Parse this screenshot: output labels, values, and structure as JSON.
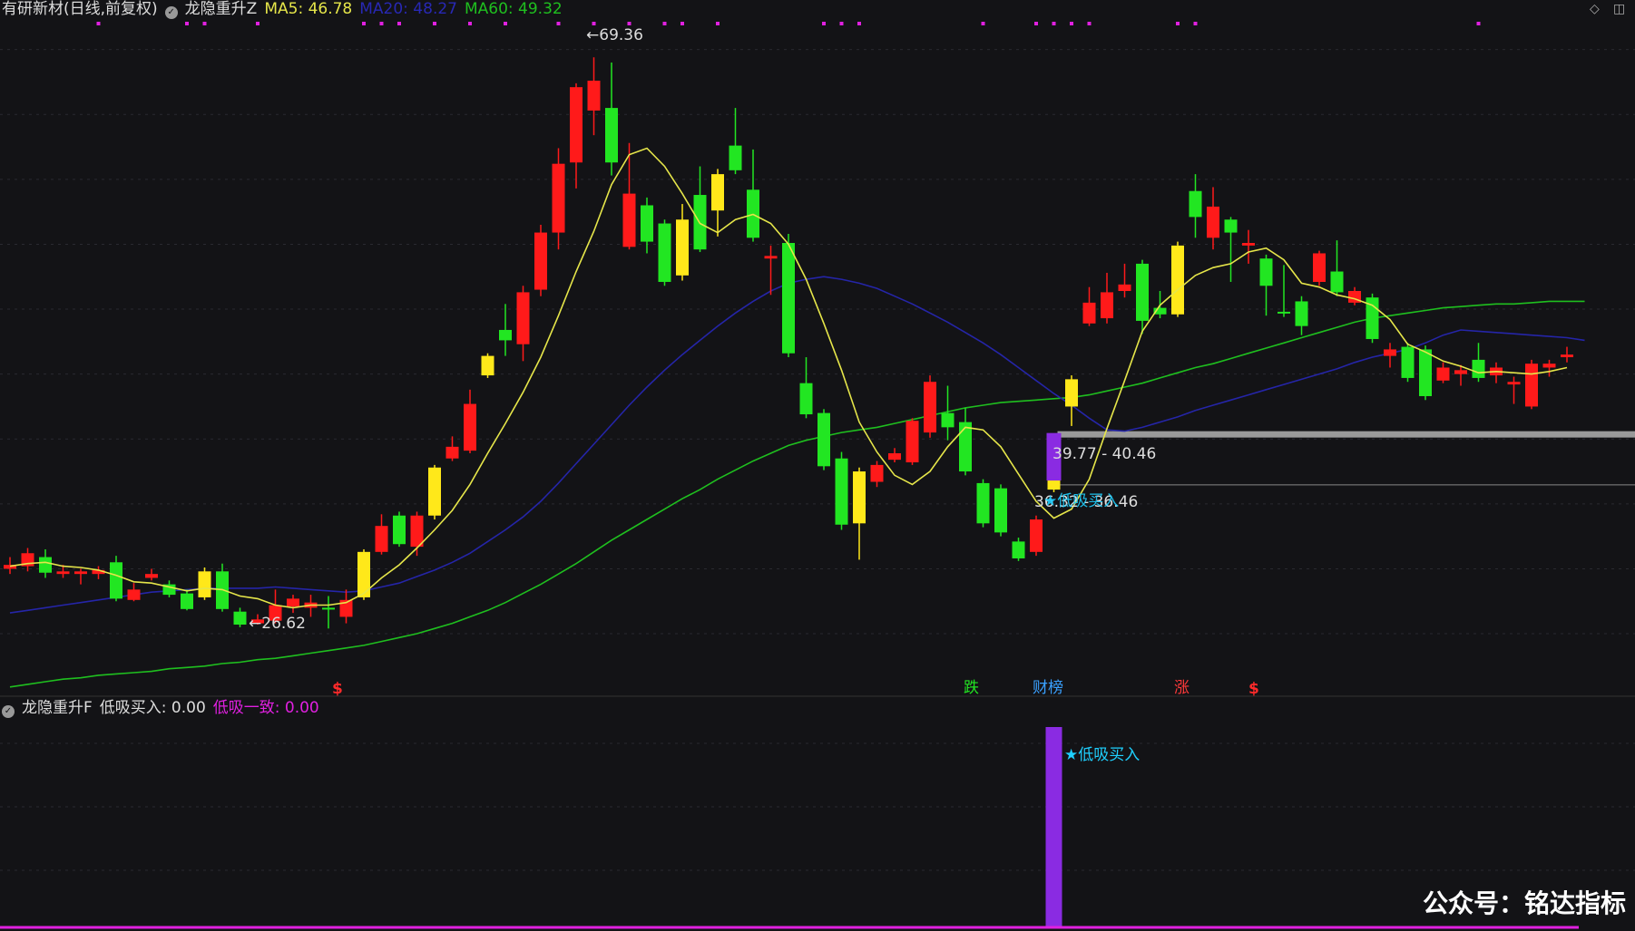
{
  "header": {
    "stock_title": "有研新材(日线,前复权)",
    "indicator_name": "龙隐重升Z",
    "ma5_label": "MA5: 46.78",
    "ma20_label": "MA20: 48.27",
    "ma60_label": "MA60: 49.32"
  },
  "sub_header": {
    "indicator_name": "龙隐重升F",
    "buy_label": "低吸买入: 0.00",
    "consensus_label": "低吸一致: 0.00"
  },
  "annotations": {
    "high": "69.36",
    "low": "26.62",
    "zone1": "39.77 - 40.46",
    "zone2": "36.32 - 36.46",
    "buy_signal": "★低吸买入",
    "sub_buy_signal": "★低吸买入",
    "dollar": "$",
    "die": "跌",
    "caibang": "财榜",
    "zhang": "涨"
  },
  "watermark": "公众号：铭达指标",
  "colors": {
    "background": "#131316",
    "up": "#ff1a1a",
    "down": "#22e622",
    "flat": "#ffe81a",
    "ma5": "#e6e64a",
    "ma20": "#2525a8",
    "ma60": "#1fbf1f",
    "signal": "#8a2be2",
    "magenta": "#e020e0",
    "cyan": "#1fd0ff"
  },
  "chart_data": {
    "type": "candlestick",
    "ylim": [
      22,
      72
    ],
    "candles": [
      {
        "o": 30.0,
        "c": 30.3,
        "h": 30.9,
        "l": 29.6,
        "t": "r"
      },
      {
        "o": 30.2,
        "c": 31.2,
        "h": 31.6,
        "l": 29.8,
        "t": "r"
      },
      {
        "o": 30.9,
        "c": 29.7,
        "h": 31.5,
        "l": 29.3,
        "t": "g"
      },
      {
        "o": 29.6,
        "c": 29.8,
        "h": 30.3,
        "l": 29.3,
        "t": "r"
      },
      {
        "o": 29.6,
        "c": 29.8,
        "h": 30.0,
        "l": 28.8,
        "t": "r"
      },
      {
        "o": 29.6,
        "c": 29.9,
        "h": 30.2,
        "l": 29.2,
        "t": "r"
      },
      {
        "o": 30.5,
        "c": 27.7,
        "h": 31.0,
        "l": 27.5,
        "t": "g"
      },
      {
        "o": 27.6,
        "c": 28.4,
        "h": 28.9,
        "l": 27.5,
        "t": "r"
      },
      {
        "o": 29.3,
        "c": 29.6,
        "h": 30.0,
        "l": 29.1,
        "t": "r"
      },
      {
        "o": 28.8,
        "c": 28.0,
        "h": 29.1,
        "l": 27.8,
        "t": "g"
      },
      {
        "o": 28.1,
        "c": 26.9,
        "h": 28.4,
        "l": 26.8,
        "t": "g"
      },
      {
        "o": 27.8,
        "c": 29.8,
        "h": 30.1,
        "l": 27.6,
        "t": "y"
      },
      {
        "o": 29.8,
        "c": 26.9,
        "h": 30.4,
        "l": 26.7,
        "t": "g"
      },
      {
        "o": 26.7,
        "c": 25.7,
        "h": 27.0,
        "l": 25.5,
        "t": "g"
      },
      {
        "o": 25.8,
        "c": 26.1,
        "h": 26.5,
        "l": 25.7,
        "t": "r"
      },
      {
        "o": 26.0,
        "c": 27.2,
        "h": 28.4,
        "l": 25.8,
        "t": "r"
      },
      {
        "o": 27.1,
        "c": 27.7,
        "h": 28.0,
        "l": 26.6,
        "t": "r"
      },
      {
        "o": 27.0,
        "c": 27.4,
        "h": 28.0,
        "l": 26.3,
        "t": "r"
      },
      {
        "o": 26.9,
        "c": 27.0,
        "h": 27.9,
        "l": 25.4,
        "t": "g"
      },
      {
        "o": 26.3,
        "c": 27.6,
        "h": 28.4,
        "l": 25.8,
        "t": "r"
      },
      {
        "o": 27.8,
        "c": 31.3,
        "h": 31.5,
        "l": 27.6,
        "t": "y"
      },
      {
        "o": 31.3,
        "c": 33.3,
        "h": 34.2,
        "l": 31.1,
        "t": "r"
      },
      {
        "o": 34.1,
        "c": 31.9,
        "h": 34.4,
        "l": 31.7,
        "t": "g"
      },
      {
        "o": 31.7,
        "c": 34.1,
        "h": 34.4,
        "l": 31.0,
        "t": "r"
      },
      {
        "o": 34.1,
        "c": 37.8,
        "h": 38.0,
        "l": 33.8,
        "t": "y"
      },
      {
        "o": 38.5,
        "c": 39.4,
        "h": 40.2,
        "l": 38.3,
        "t": "r"
      },
      {
        "o": 39.1,
        "c": 42.7,
        "h": 43.8,
        "l": 38.9,
        "t": "r"
      },
      {
        "o": 44.9,
        "c": 46.4,
        "h": 46.6,
        "l": 44.7,
        "t": "y"
      },
      {
        "o": 48.4,
        "c": 47.6,
        "h": 50.4,
        "l": 46.4,
        "t": "g"
      },
      {
        "o": 47.3,
        "c": 51.3,
        "h": 51.8,
        "l": 46.0,
        "t": "r"
      },
      {
        "o": 51.5,
        "c": 55.9,
        "h": 56.5,
        "l": 51.0,
        "t": "r"
      },
      {
        "o": 55.9,
        "c": 61.2,
        "h": 62.4,
        "l": 54.6,
        "t": "r"
      },
      {
        "o": 61.3,
        "c": 67.1,
        "h": 67.4,
        "l": 59.3,
        "t": "r"
      },
      {
        "o": 65.3,
        "c": 67.6,
        "h": 69.4,
        "l": 63.4,
        "t": "r"
      },
      {
        "o": 65.5,
        "c": 61.3,
        "h": 69.0,
        "l": 60.3,
        "t": "g"
      },
      {
        "o": 54.8,
        "c": 58.9,
        "h": 62.8,
        "l": 54.6,
        "t": "r"
      },
      {
        "o": 58.0,
        "c": 55.2,
        "h": 58.6,
        "l": 54.3,
        "t": "g"
      },
      {
        "o": 56.6,
        "c": 52.1,
        "h": 56.9,
        "l": 51.8,
        "t": "g"
      },
      {
        "o": 56.9,
        "c": 52.6,
        "h": 58.1,
        "l": 52.2,
        "t": "y"
      },
      {
        "o": 54.6,
        "c": 58.8,
        "h": 61.0,
        "l": 54.4,
        "t": "g"
      },
      {
        "o": 57.6,
        "c": 60.4,
        "h": 60.8,
        "l": 55.6,
        "t": "y"
      },
      {
        "o": 60.7,
        "c": 62.6,
        "h": 65.5,
        "l": 60.4,
        "t": "g"
      },
      {
        "o": 59.2,
        "c": 55.5,
        "h": 62.3,
        "l": 55.2,
        "t": "g"
      },
      {
        "o": 53.9,
        "c": 54.1,
        "h": 54.9,
        "l": 51.1,
        "t": "r"
      },
      {
        "o": 55.1,
        "c": 46.6,
        "h": 55.8,
        "l": 46.3,
        "t": "g"
      },
      {
        "o": 44.3,
        "c": 41.9,
        "h": 46.3,
        "l": 41.6,
        "t": "g"
      },
      {
        "o": 42.0,
        "c": 37.9,
        "h": 42.3,
        "l": 37.6,
        "t": "g"
      },
      {
        "o": 38.5,
        "c": 33.4,
        "h": 39.0,
        "l": 33.0,
        "t": "g"
      },
      {
        "o": 37.5,
        "c": 33.5,
        "h": 37.8,
        "l": 30.7,
        "t": "y"
      },
      {
        "o": 38.0,
        "c": 36.7,
        "h": 38.3,
        "l": 36.3,
        "t": "r"
      },
      {
        "o": 38.4,
        "c": 38.9,
        "h": 39.3,
        "l": 38.2,
        "t": "r"
      },
      {
        "o": 38.2,
        "c": 41.4,
        "h": 41.6,
        "l": 38.0,
        "t": "r"
      },
      {
        "o": 40.5,
        "c": 44.4,
        "h": 44.9,
        "l": 40.1,
        "t": "r"
      },
      {
        "o": 42.0,
        "c": 40.9,
        "h": 44.1,
        "l": 39.9,
        "t": "g"
      },
      {
        "o": 41.3,
        "c": 37.5,
        "h": 42.4,
        "l": 37.2,
        "t": "g"
      },
      {
        "o": 36.6,
        "c": 33.5,
        "h": 36.9,
        "l": 33.2,
        "t": "g"
      },
      {
        "o": 36.2,
        "c": 32.8,
        "h": 36.5,
        "l": 32.5,
        "t": "g"
      },
      {
        "o": 32.1,
        "c": 30.8,
        "h": 32.4,
        "l": 30.6,
        "t": "g"
      },
      {
        "o": 31.3,
        "c": 33.8,
        "h": 34.1,
        "l": 31.0,
        "t": "r"
      },
      {
        "o": 36.1,
        "c": 39.1,
        "h": 39.4,
        "l": 35.9,
        "t": "y"
      },
      {
        "o": 42.5,
        "c": 44.6,
        "h": 44.9,
        "l": 41.0,
        "t": "y"
      },
      {
        "o": 48.9,
        "c": 50.5,
        "h": 51.7,
        "l": 48.7,
        "t": "r"
      },
      {
        "o": 49.3,
        "c": 51.3,
        "h": 52.8,
        "l": 48.9,
        "t": "r"
      },
      {
        "o": 51.4,
        "c": 51.9,
        "h": 53.5,
        "l": 50.9,
        "t": "r"
      },
      {
        "o": 53.5,
        "c": 49.1,
        "h": 53.8,
        "l": 48.1,
        "t": "g"
      },
      {
        "o": 50.1,
        "c": 49.6,
        "h": 51.4,
        "l": 49.3,
        "t": "g"
      },
      {
        "o": 49.6,
        "c": 54.9,
        "h": 55.2,
        "l": 49.4,
        "t": "y"
      },
      {
        "o": 59.1,
        "c": 57.1,
        "h": 60.4,
        "l": 55.5,
        "t": "g"
      },
      {
        "o": 57.9,
        "c": 55.5,
        "h": 59.4,
        "l": 54.6,
        "t": "r"
      },
      {
        "o": 56.9,
        "c": 55.9,
        "h": 57.1,
        "l": 52.1,
        "t": "g"
      },
      {
        "o": 54.9,
        "c": 55.1,
        "h": 56.1,
        "l": 53.5,
        "t": "r"
      },
      {
        "o": 53.9,
        "c": 51.8,
        "h": 54.2,
        "l": 49.5,
        "t": "g"
      },
      {
        "o": 49.8,
        "c": 49.7,
        "h": 53.4,
        "l": 49.4,
        "t": "g"
      },
      {
        "o": 50.6,
        "c": 48.7,
        "h": 51.0,
        "l": 48.0,
        "t": "g"
      },
      {
        "o": 52.1,
        "c": 54.3,
        "h": 54.5,
        "l": 51.8,
        "t": "r"
      },
      {
        "o": 52.9,
        "c": 51.3,
        "h": 55.3,
        "l": 51.0,
        "t": "g"
      },
      {
        "o": 50.5,
        "c": 51.4,
        "h": 51.7,
        "l": 50.3,
        "t": "r"
      },
      {
        "o": 50.9,
        "c": 47.7,
        "h": 51.2,
        "l": 47.4,
        "t": "g"
      },
      {
        "o": 46.4,
        "c": 46.9,
        "h": 47.4,
        "l": 45.5,
        "t": "r"
      },
      {
        "o": 47.1,
        "c": 44.7,
        "h": 47.4,
        "l": 44.4,
        "t": "g"
      },
      {
        "o": 46.9,
        "c": 43.3,
        "h": 47.2,
        "l": 43.0,
        "t": "g"
      },
      {
        "o": 44.5,
        "c": 45.5,
        "h": 45.9,
        "l": 44.3,
        "t": "r"
      },
      {
        "o": 45.0,
        "c": 45.3,
        "h": 45.7,
        "l": 44.1,
        "t": "r"
      },
      {
        "o": 46.1,
        "c": 44.7,
        "h": 47.4,
        "l": 44.4,
        "t": "g"
      },
      {
        "o": 44.9,
        "c": 45.5,
        "h": 45.9,
        "l": 44.3,
        "t": "r"
      },
      {
        "o": 44.2,
        "c": 44.4,
        "h": 44.8,
        "l": 42.7,
        "t": "r"
      },
      {
        "o": 42.5,
        "c": 45.8,
        "h": 46.1,
        "l": 42.3,
        "t": "r"
      },
      {
        "o": 45.5,
        "c": 45.8,
        "h": 46.1,
        "l": 44.8,
        "t": "r"
      },
      {
        "o": 46.3,
        "c": 46.5,
        "h": 47.1,
        "l": 45.9,
        "t": "r"
      }
    ],
    "ma5": [
      30.2,
      30.4,
      30.5,
      30.2,
      30.1,
      29.9,
      29.5,
      29.0,
      28.9,
      28.6,
      28.3,
      28.5,
      28.4,
      27.9,
      27.7,
      27.2,
      27.0,
      27.2,
      27.2,
      27.4,
      28.1,
      29.3,
      30.3,
      31.6,
      33.0,
      34.5,
      36.5,
      38.9,
      41.2,
      43.6,
      46.3,
      49.5,
      52.9,
      56.0,
      59.6,
      61.9,
      62.4,
      61.0,
      58.9,
      56.6,
      55.9,
      56.9,
      57.3,
      56.6,
      55.0,
      52.3,
      48.9,
      45.3,
      41.3,
      39.0,
      37.2,
      36.5,
      37.5,
      39.4,
      40.9,
      40.7,
      39.4,
      37.3,
      35.2,
      33.9,
      34.6,
      36.9,
      40.8,
      44.5,
      48.3,
      50.3,
      51.5,
      52.6,
      53.2,
      53.5,
      54.4,
      54.7,
      53.8,
      52.0,
      51.7,
      51.1,
      50.8,
      50.3,
      49.2,
      47.3,
      46.7,
      46.0,
      45.6,
      45.1,
      45.2,
      45.1,
      45.0,
      45.2,
      45.5
    ],
    "ma20": [
      26.6,
      26.8,
      27.0,
      27.2,
      27.4,
      27.6,
      27.8,
      28.0,
      28.2,
      28.3,
      28.4,
      28.5,
      28.5,
      28.5,
      28.5,
      28.6,
      28.5,
      28.4,
      28.3,
      28.2,
      28.3,
      28.6,
      28.9,
      29.4,
      29.9,
      30.5,
      31.2,
      32.1,
      33.0,
      34.0,
      35.2,
      36.6,
      38.1,
      39.6,
      41.1,
      42.6,
      44.0,
      45.3,
      46.5,
      47.6,
      48.7,
      49.7,
      50.6,
      51.4,
      52.0,
      52.3,
      52.5,
      52.3,
      52.0,
      51.6,
      51.0,
      50.4,
      49.7,
      49.0,
      48.2,
      47.4,
      46.5,
      45.5,
      44.5,
      43.5,
      42.6,
      41.6,
      40.7,
      40.6,
      40.9,
      41.3,
      41.7,
      42.2,
      42.6,
      43.0,
      43.4,
      43.8,
      44.2,
      44.6,
      45.0,
      45.4,
      45.9,
      46.3,
      46.6,
      46.9,
      47.4,
      48.0,
      48.4,
      48.3,
      48.2,
      48.1,
      48.0,
      47.9,
      47.8,
      47.6
    ],
    "ma60": [
      20.9,
      21.1,
      21.3,
      21.5,
      21.6,
      21.8,
      21.9,
      22.0,
      22.1,
      22.3,
      22.4,
      22.5,
      22.7,
      22.8,
      23.0,
      23.1,
      23.3,
      23.5,
      23.7,
      23.9,
      24.1,
      24.4,
      24.7,
      25.0,
      25.4,
      25.8,
      26.3,
      26.8,
      27.4,
      28.1,
      28.8,
      29.6,
      30.4,
      31.3,
      32.2,
      33.0,
      33.8,
      34.6,
      35.4,
      36.1,
      36.9,
      37.6,
      38.3,
      38.9,
      39.5,
      39.9,
      40.2,
      40.5,
      40.7,
      40.9,
      41.2,
      41.5,
      41.8,
      42.1,
      42.4,
      42.6,
      42.8,
      42.9,
      43.0,
      43.1,
      43.2,
      43.4,
      43.7,
      44.0,
      44.3,
      44.7,
      45.1,
      45.5,
      45.8,
      46.2,
      46.6,
      47.0,
      47.4,
      47.8,
      48.2,
      48.6,
      49.0,
      49.3,
      49.5,
      49.7,
      49.9,
      50.1,
      50.2,
      50.3,
      50.4,
      50.4,
      50.5,
      50.6,
      50.6,
      50.6
    ],
    "top_dots": [
      5,
      10,
      11,
      14,
      20,
      21,
      22,
      24,
      26,
      28,
      31,
      33,
      35,
      37,
      38,
      40,
      46,
      47,
      48,
      55,
      58,
      59,
      60,
      61,
      66,
      67,
      83
    ],
    "ma_markers": [
      {
        "i": 43,
        "v": 54.1
      }
    ],
    "signal_index": 59,
    "sub_ylim": [
      0,
      1
    ],
    "sub_values": [
      0,
      0,
      0,
      0,
      0,
      0,
      0,
      0,
      0,
      0,
      0,
      0,
      0,
      0,
      0,
      0,
      0,
      0,
      0,
      0,
      0,
      0,
      0,
      0,
      0,
      0,
      0,
      0,
      0,
      0,
      0,
      0,
      0,
      0,
      0,
      0,
      0,
      0,
      0,
      0,
      0,
      0,
      0,
      0,
      0,
      0,
      0,
      0,
      0,
      0,
      0,
      0,
      0,
      0,
      0,
      0,
      0,
      0,
      0,
      1,
      0,
      0,
      0,
      0,
      0,
      0,
      0,
      0,
      0,
      0,
      0,
      0,
      0,
      0,
      0,
      0,
      0,
      0,
      0,
      0,
      0,
      0,
      0,
      0,
      0,
      0,
      0,
      0,
      0,
      0
    ]
  }
}
